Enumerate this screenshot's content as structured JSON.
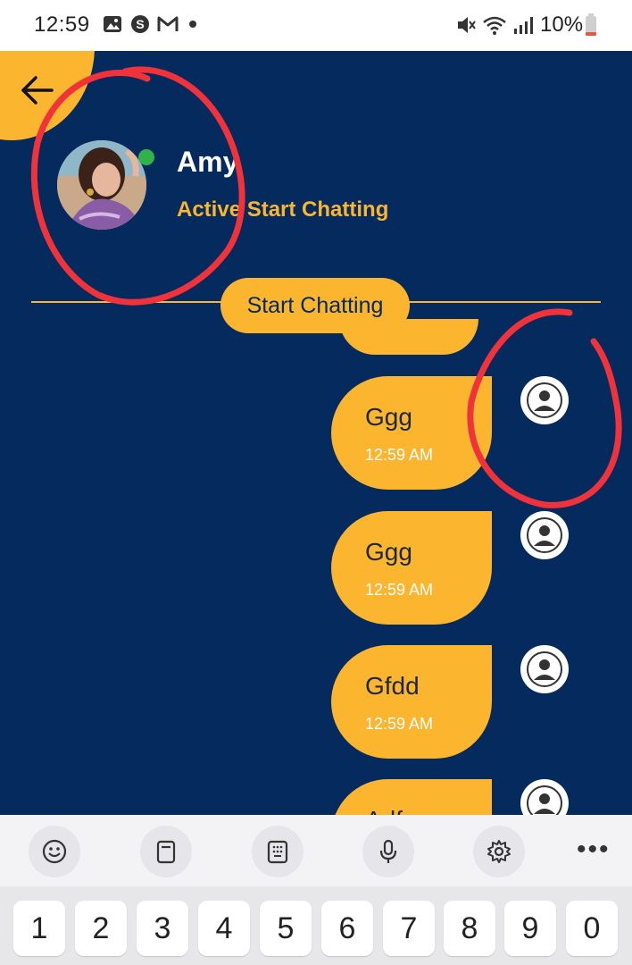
{
  "status_bar": {
    "time": "12:59",
    "battery": "10%",
    "icons": [
      "image-icon",
      "skype-icon",
      "gmail-icon",
      "dot-icon",
      "mute-icon",
      "wifi-icon",
      "signal-icon",
      "battery-icon"
    ]
  },
  "header": {
    "contact_name": "Amy",
    "status_text": "Active Start Chatting",
    "online_color": "#2fb34a"
  },
  "chat": {
    "start_label": "Start Chatting",
    "messages": [
      {
        "text": "Ggg",
        "time": "12:59 AM"
      },
      {
        "text": "Ggg",
        "time": "12:59 AM"
      },
      {
        "text": "Gfdd",
        "time": "12:59 AM"
      },
      {
        "text": "Adf",
        "time": ""
      }
    ]
  },
  "keyboard": {
    "toolbar": [
      "emoji-icon",
      "clipboard-icon",
      "keypad-icon",
      "microphone-icon",
      "settings-icon",
      "more-icon"
    ],
    "more_label": "•••",
    "keys": [
      "1",
      "2",
      "3",
      "4",
      "5",
      "6",
      "7",
      "8",
      "9",
      "0"
    ]
  },
  "colors": {
    "background": "#042a5e",
    "accent": "#fbb52f",
    "annotation": "#f0333a"
  }
}
